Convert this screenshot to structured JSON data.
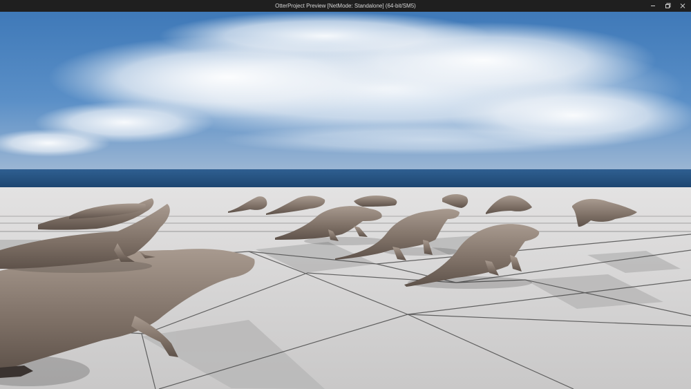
{
  "window": {
    "title": "OtterProject Preview [NetMode: Standalone]  (64-bit/SM5)",
    "controls": [
      "minimize-icon",
      "maximize-icon",
      "close-icon"
    ]
  },
  "scene": {
    "sky_color": "#4f85c0",
    "ocean_color": "#1e4d7a",
    "floor_color": "#d4d3d3",
    "floor_dark_tile_color": "#b9b8b8",
    "grid_line_color": "#2a2a2a",
    "otter_color": "#8a7c72"
  }
}
